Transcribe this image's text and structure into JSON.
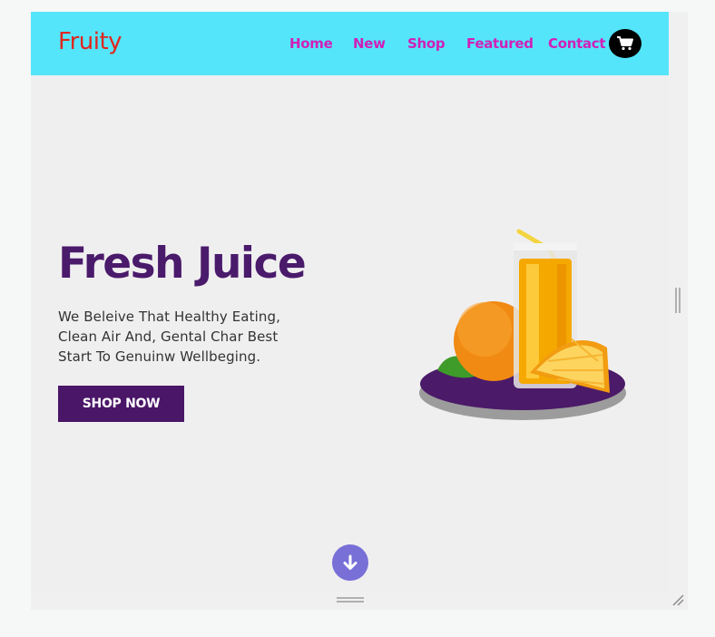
{
  "brand": {
    "name": "Fruity"
  },
  "nav": {
    "items": [
      {
        "label": "Home"
      },
      {
        "label": "New"
      },
      {
        "label": "Shop"
      },
      {
        "label": "Featured"
      },
      {
        "label": "Contact"
      }
    ],
    "cart_icon": "shopping-cart-icon"
  },
  "hero": {
    "title": "Fresh Juice",
    "text_lines": [
      "We Beleive That Healthy Eating,",
      "Clean Air And, Gental Char Best",
      "Start To Genuinw Wellbeging."
    ],
    "button_label": "SHOP NOW",
    "image": "orange-juice-glass-with-oranges-on-plate"
  },
  "scroll_icon": "arrow-down-icon",
  "colors": {
    "navbar": "#55e5fb",
    "brand": "#e0271f",
    "nav_link": "#d020b8",
    "title": "#4a1a6b",
    "button": "#4a1667",
    "scroll_button": "#7870d6"
  }
}
